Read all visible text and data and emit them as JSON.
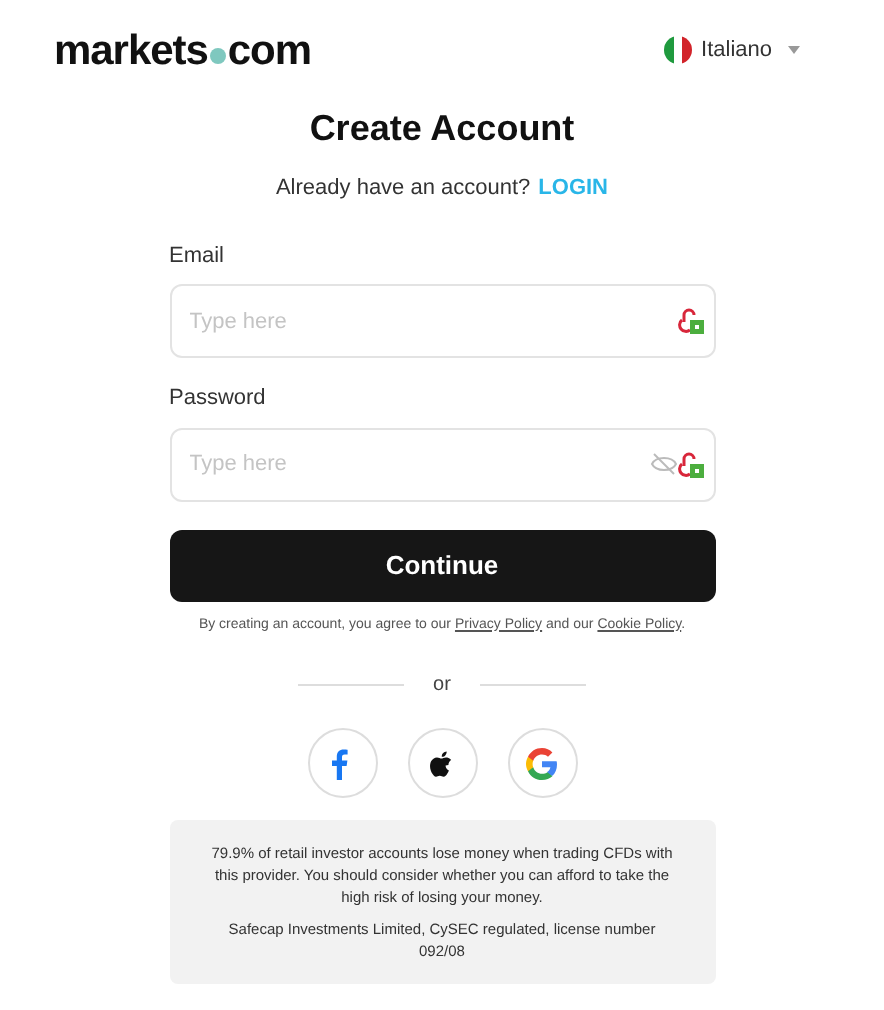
{
  "header": {
    "logo": {
      "left": "markets",
      "right": "com"
    },
    "language": {
      "label": "Italiano"
    }
  },
  "title": "Create Account",
  "login_prompt": {
    "text": "Already have an account?",
    "link": "LOGIN"
  },
  "fields": [
    {
      "label": "Email",
      "placeholder": "Type here",
      "kind": "email"
    },
    {
      "label": "Password",
      "placeholder": "Type here",
      "kind": "password"
    }
  ],
  "continue_button": "Continue",
  "agreement": {
    "before": "By creating an account, you agree to our",
    "privacy_link": "Privacy Policy",
    "middle": "and our",
    "cookie_link": "Cookie Policy",
    "after": "."
  },
  "divider": "or",
  "social_buttons": [
    {
      "kind": "facebook"
    },
    {
      "kind": "apple"
    },
    {
      "kind": "google"
    }
  ],
  "risk_notice": {
    "warning": "79.9% of retail investor accounts lose money when trading CFDs with this provider. You should consider whether you can afford to take the high risk of losing your money.",
    "license": "Safecap Investments Limited, CySEC regulated, license number 092/08"
  }
}
